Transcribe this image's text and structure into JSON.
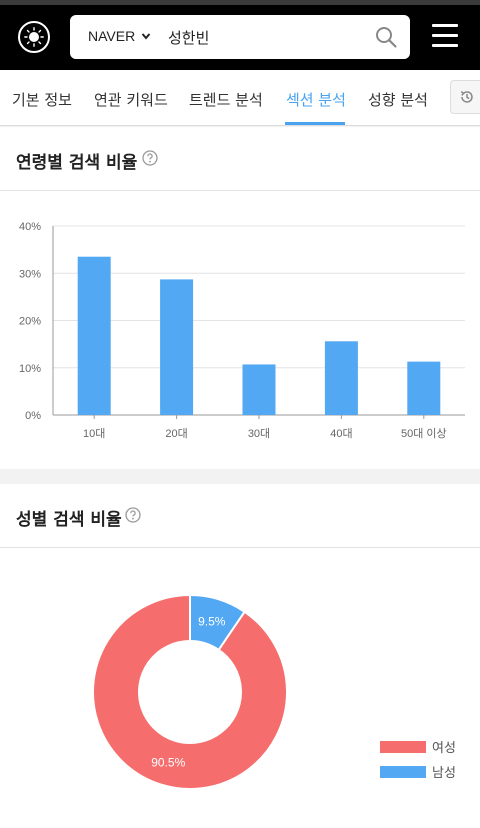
{
  "header": {
    "engine": "NAVER",
    "query": "성한빈"
  },
  "icons": {
    "logo": "sun-logo-icon",
    "engine_dropdown": "chevron-down-icon",
    "search": "search-icon",
    "menu": "hamburger-menu-icon",
    "history": "history-icon",
    "help": "question-circle-icon"
  },
  "tabs": [
    {
      "label": "기본 정보",
      "active": false
    },
    {
      "label": "연관 키워드",
      "active": false
    },
    {
      "label": "트렌드 분석",
      "active": false
    },
    {
      "label": "섹션 분석",
      "active": true
    },
    {
      "label": "성향 분석",
      "active": false
    }
  ],
  "age_section": {
    "title": "연령별 검색 비율"
  },
  "gender_section": {
    "title": "성별 검색 비율"
  },
  "colors": {
    "accent": "#4aa3f0",
    "bar": "#53a8f4",
    "female": "#f66d6d",
    "male": "#53a8f4"
  },
  "chart_data": [
    {
      "type": "bar",
      "categories": [
        "10대",
        "20대",
        "30대",
        "40대",
        "50대 이상"
      ],
      "values": [
        33.5,
        28.7,
        10.7,
        15.6,
        11.3
      ],
      "yticks": [
        "0%",
        "10%",
        "20%",
        "30%",
        "40%"
      ],
      "ylim": [
        0,
        40
      ],
      "grid": true,
      "title": "",
      "xlabel": "",
      "ylabel": ""
    },
    {
      "type": "pie",
      "style": "donut",
      "categories": [
        "여성",
        "남성"
      ],
      "values": [
        90.5,
        9.5
      ],
      "labels": [
        "90.5%",
        "9.5%"
      ],
      "legend": "right"
    }
  ]
}
